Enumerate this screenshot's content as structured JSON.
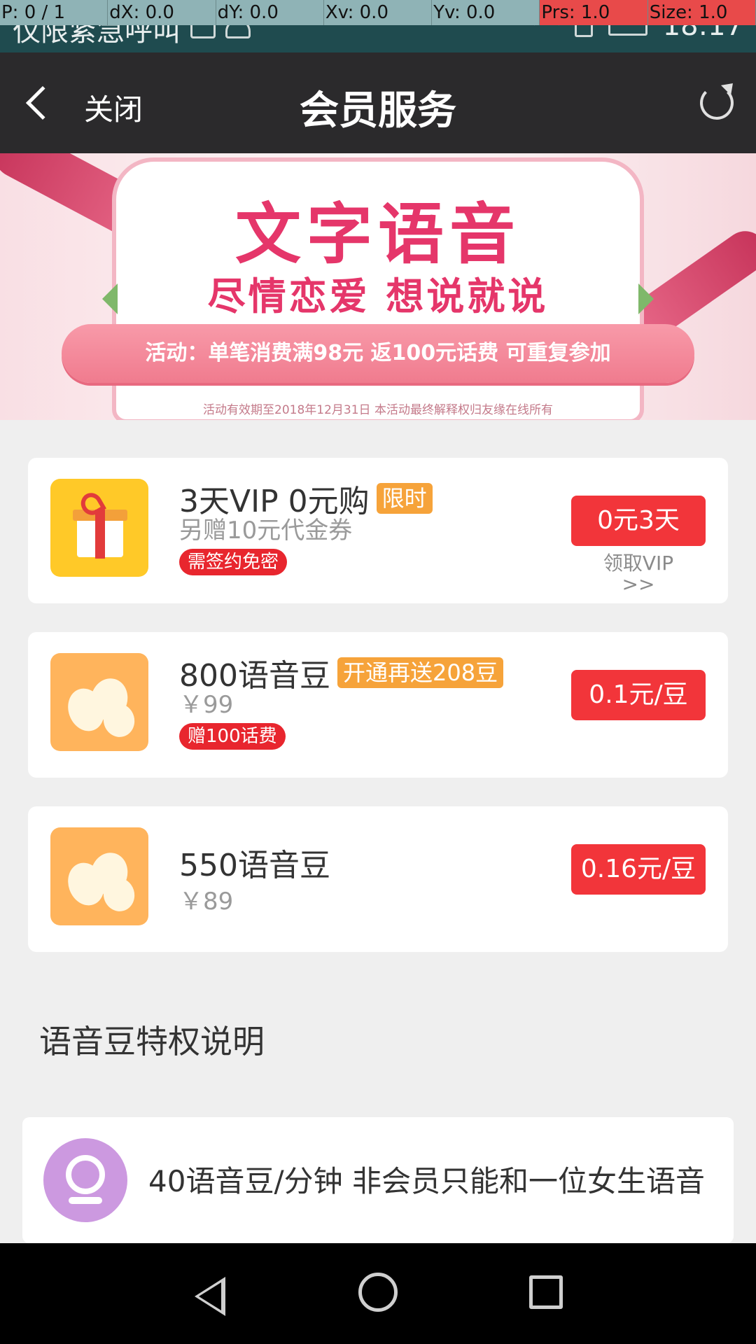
{
  "debug": {
    "pointer": "P: 0 / 1",
    "dx": "dX: 0.0",
    "dy": "dY: 0.0",
    "xv": "Xv: 0.0",
    "yv": "Yv: 0.0",
    "prs": "Prs: 1.0",
    "size": "Size: 1.0"
  },
  "status_bar": {
    "carrier": "仅限紧急呼叫",
    "time": "18:17",
    "icons": [
      "keyboard-icon",
      "android-icon",
      "wifi-icon",
      "sim-icon",
      "battery-icon"
    ]
  },
  "nav": {
    "close_label": "关闭",
    "title": "会员服务"
  },
  "banner": {
    "title": "文字语音",
    "subtitle": "尽情恋爱 想说就说",
    "promo": "活动：单笔消费满98元 返100元话费 可重复参加",
    "fine_print": "活动有效期至2018年12月31日 本活动最终解释权归友缘在线所有"
  },
  "products": [
    {
      "title": "3天VIP 0元购",
      "badge": "限时",
      "subtitle": "另赠10元代金券",
      "tag": "需签约免密",
      "price_button": "0元3天",
      "link_line1": "领取VIP",
      "link_line2": ">>",
      "icon": "gift-icon"
    },
    {
      "title": "800语音豆",
      "badge": "开通再送208豆",
      "subtitle": "￥99",
      "tag": "赠100话费",
      "price_button": "0.1元/豆",
      "icon": "bean-icon"
    },
    {
      "title": "550语音豆",
      "subtitle": "￥89",
      "price_button": "0.16元/豆",
      "icon": "bean-icon"
    }
  ],
  "privileges": {
    "heading": "语音豆特权说明",
    "items": [
      {
        "text": "40语音豆/分钟 非会员只能和一位女生语音",
        "icon": "voice-chat-icon"
      }
    ]
  },
  "colors": {
    "accent_red": "#f2353a",
    "badge_orange": "#f6a33a",
    "banner_pink": "#e5366a",
    "nav_dark": "#2b2a2c"
  }
}
